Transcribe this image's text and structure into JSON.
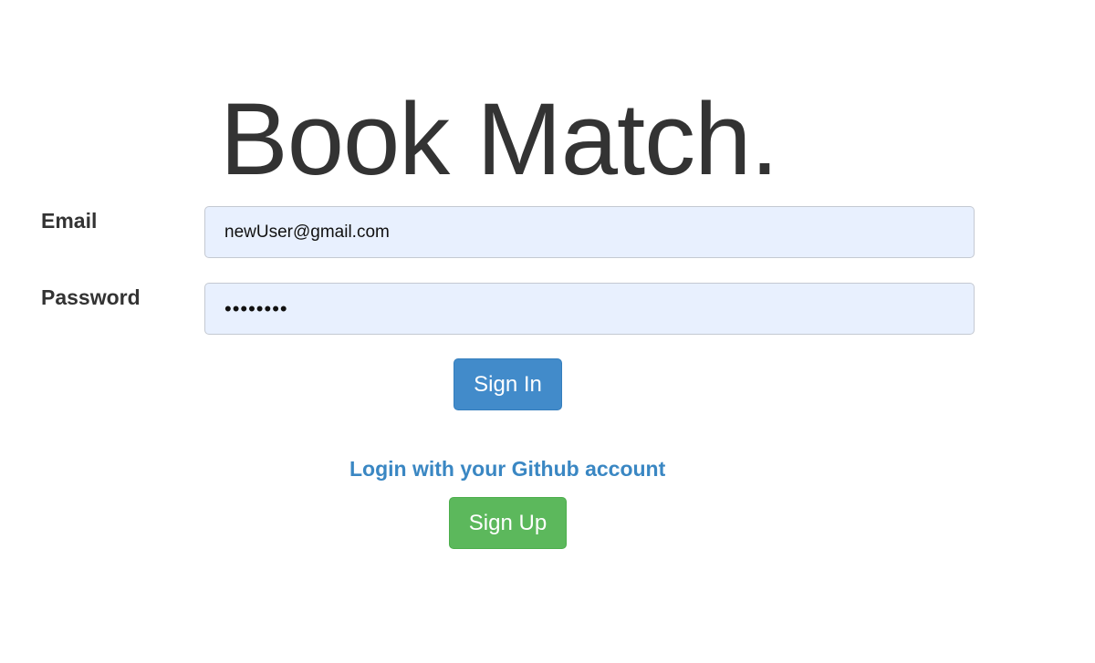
{
  "app": {
    "title": "Book Match."
  },
  "login_form": {
    "email": {
      "label": "Email",
      "value": "newUser@gmail.com"
    },
    "password": {
      "label": "Password",
      "value": "••••••••"
    },
    "sign_in_label": "Sign In",
    "github_link_text": "Login with your Github account",
    "sign_up_label": "Sign Up"
  },
  "colors": {
    "title_text": "#333333",
    "input_background": "#e8f0fe",
    "sign_in_button": "#428bca",
    "sign_up_button": "#5cb85c",
    "link_text": "#3a87c3"
  }
}
